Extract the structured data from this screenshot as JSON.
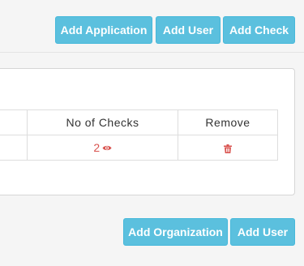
{
  "top_toolbar": {
    "add_application_label": "Add Application",
    "add_user_label": "Add User",
    "add_check_label": "Add Check"
  },
  "table": {
    "headers": [
      "",
      "No of Checks",
      "Remove"
    ],
    "rows": [
      {
        "first": "",
        "checks_count": "2",
        "view_icon": "eye-icon",
        "remove_icon": "trash-icon"
      }
    ]
  },
  "bottom_toolbar": {
    "add_organization_label": "Add Organization",
    "add_user_label": "Add User"
  },
  "colors": {
    "button_info": "#5bc0de",
    "danger": "#d9534f"
  }
}
